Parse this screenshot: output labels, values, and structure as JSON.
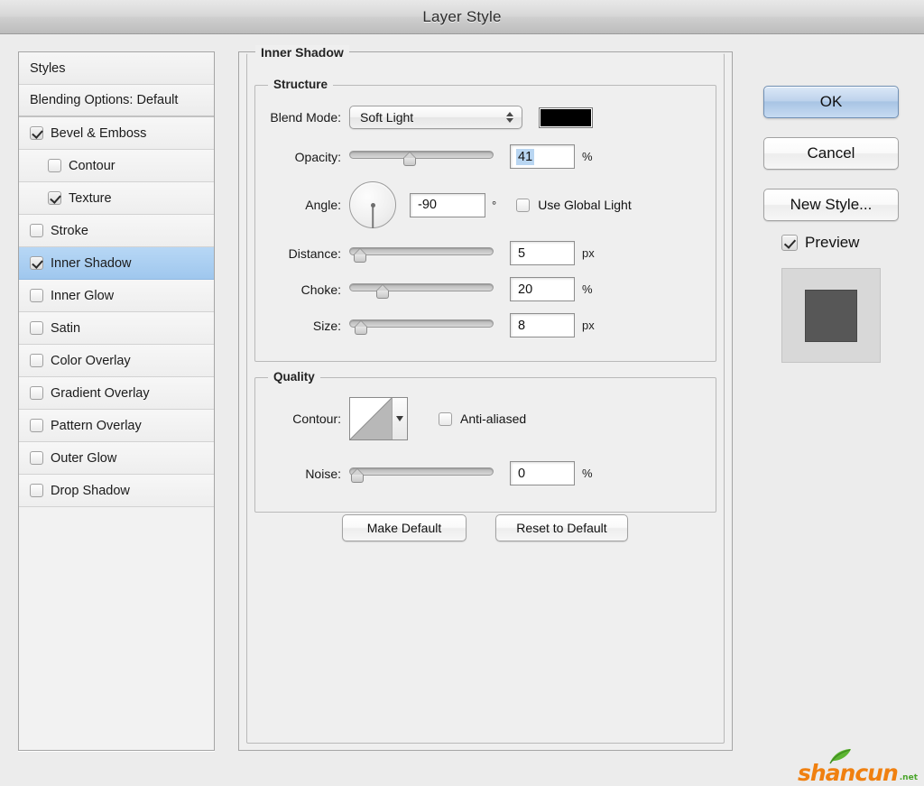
{
  "window": {
    "title": "Layer Style"
  },
  "sidebar": {
    "items": [
      {
        "label": "Styles",
        "type": "header",
        "checkbox": false,
        "checked": false,
        "indented": false,
        "selected": false
      },
      {
        "label": "Blending Options: Default",
        "type": "header",
        "checkbox": false,
        "checked": false,
        "indented": false,
        "selected": false
      },
      {
        "label": "Bevel & Emboss",
        "type": "effect",
        "checkbox": true,
        "checked": true,
        "indented": false,
        "selected": false
      },
      {
        "label": "Contour",
        "type": "effect",
        "checkbox": true,
        "checked": false,
        "indented": true,
        "selected": false
      },
      {
        "label": "Texture",
        "type": "effect",
        "checkbox": true,
        "checked": true,
        "indented": true,
        "selected": false
      },
      {
        "label": "Stroke",
        "type": "effect",
        "checkbox": true,
        "checked": false,
        "indented": false,
        "selected": false
      },
      {
        "label": "Inner Shadow",
        "type": "effect",
        "checkbox": true,
        "checked": true,
        "indented": false,
        "selected": true
      },
      {
        "label": "Inner Glow",
        "type": "effect",
        "checkbox": true,
        "checked": false,
        "indented": false,
        "selected": false
      },
      {
        "label": "Satin",
        "type": "effect",
        "checkbox": true,
        "checked": false,
        "indented": false,
        "selected": false
      },
      {
        "label": "Color Overlay",
        "type": "effect",
        "checkbox": true,
        "checked": false,
        "indented": false,
        "selected": false
      },
      {
        "label": "Gradient Overlay",
        "type": "effect",
        "checkbox": true,
        "checked": false,
        "indented": false,
        "selected": false
      },
      {
        "label": "Pattern Overlay",
        "type": "effect",
        "checkbox": true,
        "checked": false,
        "indented": false,
        "selected": false
      },
      {
        "label": "Outer Glow",
        "type": "effect",
        "checkbox": true,
        "checked": false,
        "indented": false,
        "selected": false
      },
      {
        "label": "Drop Shadow",
        "type": "effect",
        "checkbox": true,
        "checked": false,
        "indented": false,
        "selected": false
      }
    ]
  },
  "main": {
    "effect_title": "Inner Shadow",
    "structure": {
      "title": "Structure",
      "blend_mode_label": "Blend Mode:",
      "blend_mode_value": "Soft Light",
      "color_swatch": "#000000",
      "opacity_label": "Opacity:",
      "opacity_value": "41",
      "opacity_unit": "%",
      "opacity_percent": 41,
      "angle_label": "Angle:",
      "angle_value": "-90",
      "angle_unit": "°",
      "angle_degrees": -90,
      "use_global_light_label": "Use Global Light",
      "use_global_light_checked": false,
      "distance_label": "Distance:",
      "distance_value": "5",
      "distance_unit": "px",
      "distance_percent": 2,
      "choke_label": "Choke:",
      "choke_value": "20",
      "choke_unit": "%",
      "choke_percent": 20,
      "size_label": "Size:",
      "size_value": "8",
      "size_unit": "px",
      "size_percent": 3
    },
    "quality": {
      "title": "Quality",
      "contour_label": "Contour:",
      "anti_aliased_label": "Anti-aliased",
      "anti_aliased_checked": false,
      "noise_label": "Noise:",
      "noise_value": "0",
      "noise_unit": "%",
      "noise_percent": 0
    },
    "buttons": {
      "make_default": "Make Default",
      "reset_to_default": "Reset to Default"
    }
  },
  "right": {
    "ok": "OK",
    "cancel": "Cancel",
    "new_style": "New Style...",
    "preview_label": "Preview",
    "preview_checked": true
  },
  "watermark": {
    "name": "shancun",
    "suffix": ".net"
  },
  "colors": {
    "accent_selection": "#a8ccf0",
    "default_button": "#a8c4e4",
    "dialog_bg": "#ececec",
    "watermark_orange": "#f08010",
    "watermark_green": "#4aa52a"
  }
}
